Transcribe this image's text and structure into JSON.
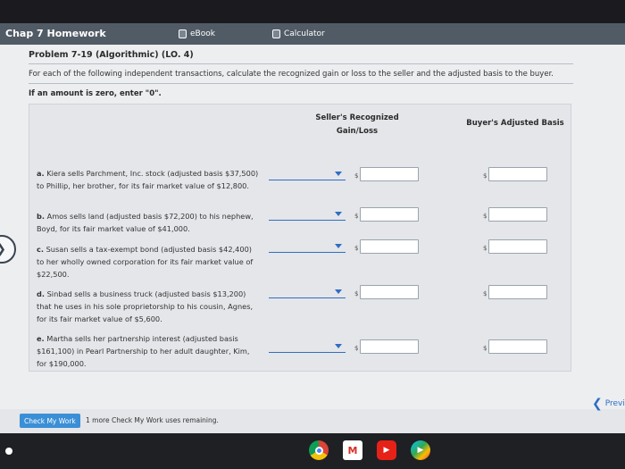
{
  "window": {
    "title": "Chap 7 Homework"
  },
  "tabs": [
    {
      "label": "eBook",
      "icon": "book-icon"
    },
    {
      "label": "Calculator",
      "icon": "calculator-icon"
    }
  ],
  "problem": {
    "title": "Problem 7-19 (Algorithmic) (LO. 4)",
    "instructions": "For each of the following independent transactions, calculate the recognized gain or loss to the seller and the adjusted basis to the buyer.",
    "zero_note": "If an amount is zero, enter \"0\"."
  },
  "table": {
    "col_seller": "Seller's Recognized Gain/Loss",
    "col_buyer": "Buyer's Adjusted Basis",
    "currency_symbol": "$",
    "rows": [
      {
        "letter": "a.",
        "text": "Kiera sells Parchment, Inc. stock (adjusted basis $37,500) to Phillip, her brother, for its fair market value of $12,800.",
        "seller_value": "",
        "buyer_value": ""
      },
      {
        "letter": "b.",
        "text": "Amos sells land (adjusted basis $72,200) to his nephew, Boyd, for its fair market value of $41,000.",
        "seller_value": "",
        "buyer_value": ""
      },
      {
        "letter": "c.",
        "text": "Susan sells a tax-exempt bond (adjusted basis $42,400) to her wholly owned corporation for its fair market value of $22,500.",
        "seller_value": "",
        "buyer_value": ""
      },
      {
        "letter": "d.",
        "text": "Sinbad sells a business truck (adjusted basis $13,200) that he uses in his sole proprietorship to his cousin, Agnes, for its fair market value of $5,600.",
        "seller_value": "",
        "buyer_value": ""
      },
      {
        "letter": "e.",
        "text": "Martha sells her partnership interest (adjusted basis $161,100) in Pearl Partnership to her adult daughter, Kim, for $190,000.",
        "seller_value": "",
        "buyer_value": ""
      }
    ]
  },
  "footer": {
    "check_button": "Check My Work",
    "remaining_text": "1 more Check My Work uses remaining.",
    "prev_label": "Previ"
  },
  "colors": {
    "accent": "#3b8fd6",
    "tabbar": "#515b66"
  },
  "dock": [
    "chrome-icon",
    "gmail-icon",
    "youtube-icon",
    "play-store-icon"
  ]
}
